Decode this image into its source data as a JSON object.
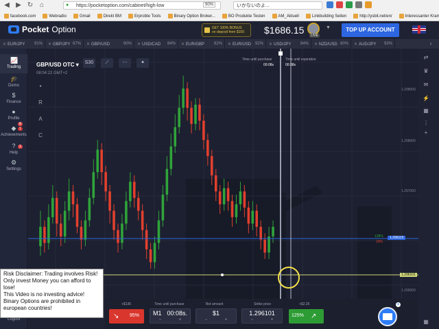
{
  "browser": {
    "url": "https://pocketoption.com/cabinet/high-low",
    "zoom": "90%",
    "search_text": "いかないのよ...",
    "bookmarks": [
      "facebook.com",
      "Webradio",
      "Gmail",
      "Direkt BM",
      "Erprobte Tools",
      "Binary Option Broker...",
      "BO Produkte Testen",
      "AM_Aktuell",
      "Linkbuilding Seiten",
      "http://ysbit.net/en/",
      "Interessanter Krams"
    ]
  },
  "header": {
    "logo_bold": "Pocket",
    "logo_light": " Option",
    "bonus_line1": "GET 100% BONUS",
    "bonus_line2": "on deposit from $100",
    "balance": "$1686.15",
    "account_level": "LIVE",
    "topup_label": "TOP UP ACCOUNT"
  },
  "asset_tabs": [
    {
      "name": "EUR/JPY",
      "pct": "91%"
    },
    {
      "name": "GBP/JPY",
      "pct": "87%"
    },
    {
      "name": "GBP/USD",
      "pct": "90%"
    },
    {
      "name": "USD/CAD",
      "pct": "84%"
    },
    {
      "name": "EUR/GBP",
      "pct": "82%"
    },
    {
      "name": "EUR/USD",
      "pct": "92%"
    },
    {
      "name": "USD/JPY",
      "pct": "84%"
    },
    {
      "name": "NZD/USD",
      "pct": "80%"
    },
    {
      "name": "AUD/JPY",
      "pct": "93%"
    }
  ],
  "sidebar": {
    "items": [
      {
        "label": "Trading",
        "icon": "chart-icon"
      },
      {
        "label": "Demo",
        "icon": "graduation-cap-icon"
      },
      {
        "label": "Finance",
        "icon": "dollar-icon"
      },
      {
        "label": "Profile",
        "icon": "user-icon"
      },
      {
        "label": "Achievements",
        "icon": "diamond-icon"
      },
      {
        "label": "Help",
        "icon": "question-icon"
      },
      {
        "label": "Settings",
        "icon": "gear-icon"
      }
    ],
    "logout": "Logout"
  },
  "chart": {
    "pair": "GBP/USD OTC",
    "server_time": "08:04:22 GMT+2",
    "timeframe": "S30",
    "time_until_purchase_label": "Time until purchase",
    "time_until_purchase": "00:08s",
    "time_until_expiration_label": "Time until expiration",
    "time_until_expiration": "00:38s",
    "side_tools": [
      "briefcase",
      "R",
      "A",
      "C"
    ],
    "y_labels": [
      "1.298000",
      "1.298000",
      "1.297000",
      "1.296115",
      "1.296101",
      "1.295000"
    ],
    "profit_up": "128%",
    "profit_down": "19%"
  },
  "trade_panel": {
    "payout_left": "+$136",
    "payout_right": "+$2.26",
    "put_pct": "95%",
    "call_pct": "125%",
    "time_label": "Time until purchase",
    "time_mode": "M1",
    "time_value": "00:08s.",
    "bet_label": "Bet amount",
    "bet_value": "$1",
    "strike_label": "Strike price",
    "strike_value": "1.296101"
  },
  "disclaimer": {
    "lines": [
      "Risk Disclaimer: Trading involves Risk!",
      "Only invest Money you can afford to lose!",
      "This Video is no investing advice!",
      "Binary Options are prohibited in european countries!"
    ]
  },
  "colors": {
    "up_candle": "#2fa43a",
    "down_candle": "#e2402e",
    "accent": "#2d66e0",
    "background": "#1d2030"
  },
  "chart_data": {
    "type": "candlestick",
    "candles": [
      [
        1.2955,
        1.2961,
        1.2966,
        1.2952
      ],
      [
        1.2961,
        1.2956,
        1.2963,
        1.2953
      ],
      [
        1.2956,
        1.2964,
        1.2968,
        1.2954
      ],
      [
        1.2964,
        1.297,
        1.2974,
        1.2962
      ],
      [
        1.297,
        1.2962,
        1.2972,
        1.2958
      ],
      [
        1.2962,
        1.2958,
        1.2965,
        1.2955
      ],
      [
        1.2958,
        1.2966,
        1.2969,
        1.2956
      ],
      [
        1.2966,
        1.2972,
        1.2976,
        1.2963
      ],
      [
        1.2972,
        1.2968,
        1.2974,
        1.2964
      ],
      [
        1.2968,
        1.2961,
        1.297,
        1.2959
      ],
      [
        1.2961,
        1.2957,
        1.2963,
        1.2954
      ],
      [
        1.2957,
        1.2963,
        1.2966,
        1.2955
      ],
      [
        1.2963,
        1.297,
        1.2973,
        1.2961
      ],
      [
        1.297,
        1.2978,
        1.2982,
        1.2968
      ],
      [
        1.2978,
        1.2985,
        1.2988,
        1.2976
      ],
      [
        1.2985,
        1.2978,
        1.2987,
        1.2974
      ],
      [
        1.2978,
        1.2972,
        1.298,
        1.2969
      ],
      [
        1.2972,
        1.2966,
        1.2974,
        1.2962
      ],
      [
        1.2966,
        1.296,
        1.2968,
        1.2957
      ],
      [
        1.296,
        1.2956,
        1.2962,
        1.2953
      ],
      [
        1.2956,
        1.2962,
        1.2965,
        1.2954
      ],
      [
        1.2962,
        1.2969,
        1.2972,
        1.296
      ],
      [
        1.2969,
        1.2975,
        1.2978,
        1.2967
      ],
      [
        1.2975,
        1.297,
        1.2977,
        1.2967
      ],
      [
        1.297,
        1.2966,
        1.2972,
        1.2963
      ],
      [
        1.2966,
        1.296,
        1.2968,
        1.2957
      ],
      [
        1.296,
        1.2954,
        1.2962,
        1.2951
      ],
      [
        1.2954,
        1.295,
        1.2956,
        1.2948
      ],
      [
        1.295,
        1.2956,
        1.2958,
        1.2948
      ],
      [
        1.2956,
        1.2963,
        1.2966,
        1.2954
      ],
      [
        1.2963,
        1.2971,
        1.2974,
        1.2961
      ],
      [
        1.2971,
        1.2979,
        1.2983,
        1.2969
      ],
      [
        1.2979,
        1.2986,
        1.299,
        1.2977
      ],
      [
        1.2986,
        1.2992,
        1.2996,
        1.2984
      ],
      [
        1.2992,
        1.2998,
        1.3002,
        1.299
      ],
      [
        1.2998,
        1.3004,
        1.3008,
        1.2996
      ],
      [
        1.3004,
        1.2998,
        1.3006,
        1.2994
      ],
      [
        1.2998,
        1.2993,
        1.3,
        1.299
      ],
      [
        1.2993,
        1.2999,
        1.3001,
        1.2991
      ],
      [
        1.2999,
        1.2994,
        1.3001,
        1.2991
      ],
      [
        1.2994,
        1.2988,
        1.2996,
        1.2985
      ],
      [
        1.2988,
        1.2983,
        1.299,
        1.298
      ],
      [
        1.2983,
        1.2977,
        1.2985,
        1.2974
      ],
      [
        1.2977,
        1.2972,
        1.2979,
        1.2969
      ],
      [
        1.2972,
        1.2968,
        1.2974,
        1.2965
      ],
      [
        1.2968,
        1.2973,
        1.2976,
        1.2966
      ],
      [
        1.2973,
        1.2969,
        1.2975,
        1.2966
      ],
      [
        1.2969,
        1.2964,
        1.2971,
        1.2961
      ],
      [
        1.2964,
        1.2968,
        1.2971,
        1.2962
      ],
      [
        1.2968,
        1.2972,
        1.2975,
        1.2966
      ],
      [
        1.2972,
        1.2967,
        1.2974,
        1.2964
      ],
      [
        1.2967,
        1.2962,
        1.2969,
        1.2959
      ],
      [
        1.2962,
        1.2966,
        1.2969,
        1.296
      ],
      [
        1.2966,
        1.2961,
        1.2968,
        1.2958
      ],
      [
        1.2961,
        1.2957,
        1.2963,
        1.2954
      ],
      [
        1.2957,
        1.2953,
        1.2959,
        1.2951
      ],
      [
        1.2953,
        1.2958,
        1.2961,
        1.2951
      ],
      [
        1.2958,
        1.2961,
        1.2963,
        1.2956
      ]
    ],
    "current_price": 1.296101,
    "y_range": [
      1.2945,
      1.301
    ]
  }
}
